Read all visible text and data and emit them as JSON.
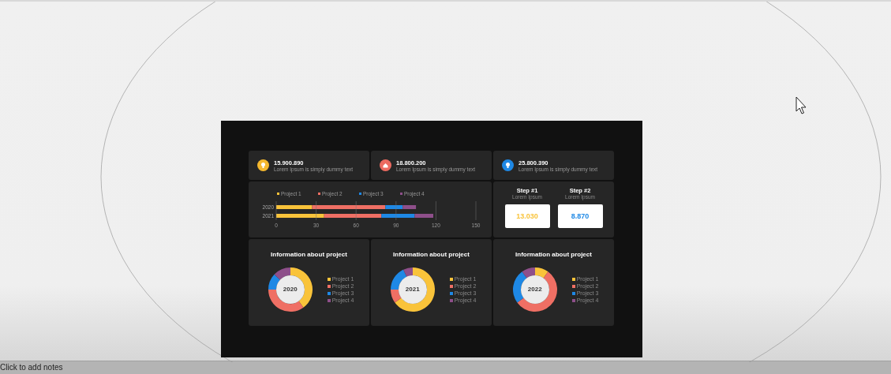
{
  "stats": [
    {
      "value": "15.900.890",
      "text": "Lorem Ipsum is simply dummy text",
      "color": "#f5b82e"
    },
    {
      "value": "18.800.200",
      "text": "Lorem Ipsum is simply dummy text",
      "color": "#ec6a60"
    },
    {
      "value": "25.800.390",
      "text": "Lorem Ipsum is simply dummy text",
      "color": "#1e88e5"
    }
  ],
  "bar_chart": {
    "chart_data": {
      "type": "bar",
      "orientation": "horizontal",
      "stacked": true,
      "grid": true,
      "legend": true,
      "categories": [
        "2020",
        "2021"
      ],
      "xlim": [
        0,
        150
      ],
      "xticks": [
        0,
        30,
        60,
        90,
        120,
        150
      ],
      "series": [
        {
          "name": "Project 1",
          "color": "#f9c33a",
          "values": [
            27,
            36
          ]
        },
        {
          "name": "Project 2",
          "color": "#ef6f64",
          "values": [
            55,
            43
          ]
        },
        {
          "name": "Project 3",
          "color": "#1e88e5",
          "values": [
            13,
            25
          ]
        },
        {
          "name": "Project 4",
          "color": "#8e4f8a",
          "values": [
            10,
            14
          ]
        }
      ]
    }
  },
  "steps": [
    {
      "title": "Step #1",
      "subtitle": "Lorem Ipsum",
      "value": "13.030",
      "color": "#f9c33a"
    },
    {
      "title": "Step #2",
      "subtitle": "Lorem Ipsum",
      "value": "8.870",
      "color": "#1e88e5"
    }
  ],
  "donut_panels": [
    {
      "title": "Information about project",
      "year": "2020",
      "legend": [
        {
          "name": "Project 1",
          "color": "#f9c33a"
        },
        {
          "name": "Project 2",
          "color": "#ef6f64"
        },
        {
          "name": "Project 3",
          "color": "#1e88e5"
        },
        {
          "name": "Project 4",
          "color": "#8e4f8a"
        }
      ]
    },
    {
      "title": "Information about project",
      "year": "2021",
      "legend": [
        {
          "name": "Project 1",
          "color": "#f9c33a"
        },
        {
          "name": "Project 2",
          "color": "#ef6f64"
        },
        {
          "name": "Project 3",
          "color": "#1e88e5"
        },
        {
          "name": "Project 4",
          "color": "#8e4f8a"
        }
      ]
    },
    {
      "title": "Information about project",
      "year": "2022",
      "legend": [
        {
          "name": "Project 1",
          "color": "#f9c33a"
        },
        {
          "name": "Project 2",
          "color": "#ef6f64"
        },
        {
          "name": "Project 3",
          "color": "#1e88e5"
        },
        {
          "name": "Project 4",
          "color": "#8e4f8a"
        }
      ]
    }
  ],
  "notes": {
    "placeholder": "Click to add notes"
  }
}
